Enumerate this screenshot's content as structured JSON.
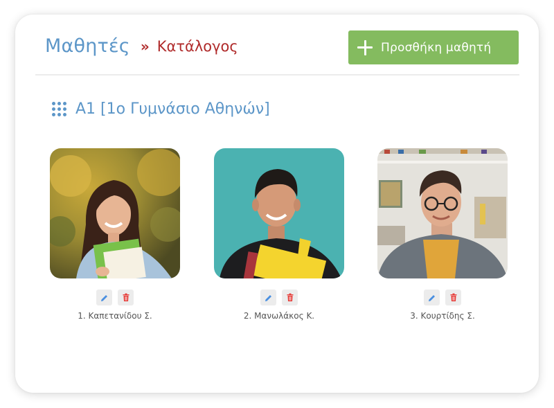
{
  "breadcrumb": {
    "root": "Μαθητές",
    "separator": "»",
    "current": "Κατάλογος"
  },
  "add_button": {
    "label": "Προσθήκη μαθητή",
    "icon": "plus-icon"
  },
  "class_heading": {
    "icon": "grid-dots-icon",
    "label": "A1 [1ο Γυμνάσιο Αθηνών]"
  },
  "students": [
    {
      "name": "1. Καπετανίδου Σ."
    },
    {
      "name": "2. Μανωλάκος Κ."
    },
    {
      "name": "3. Κουρτίδης Σ."
    }
  ],
  "colors": {
    "accent_blue": "#5c96c8",
    "breadcrumb_red": "#b02b2b",
    "button_green": "#84bb5f",
    "edit_icon_blue": "#4a8fe0",
    "delete_icon_red": "#e53935"
  }
}
